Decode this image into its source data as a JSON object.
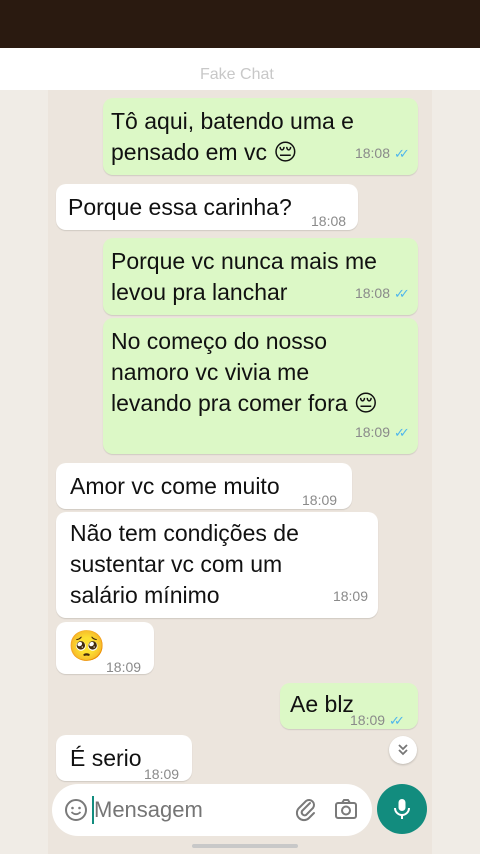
{
  "header": {
    "title": "Fake Chat"
  },
  "messages": [
    {
      "dir": "out",
      "text": "Tô aqui, batendo uma e\npensado em vc 😔",
      "time": "18:08"
    },
    {
      "dir": "in",
      "text": "Porque essa carinha?",
      "time": "18:08"
    },
    {
      "dir": "out",
      "text": "Porque vc nunca mais me\nlevou pra lanchar",
      "time": "18:08"
    },
    {
      "dir": "out",
      "text": "No começo do nosso\nnamoro vc vivia me\nlevando pra comer fora 😔",
      "time": "18:09"
    },
    {
      "dir": "in",
      "text": "Amor vc come muito",
      "time": "18:09"
    },
    {
      "dir": "in",
      "text": "Não tem condições de\nsustentar vc com um\nsalário mínimo",
      "time": "18:09"
    },
    {
      "dir": "in",
      "text": "🥺",
      "time": "18:09"
    },
    {
      "dir": "out",
      "text": "Ae blz",
      "time": "18:09"
    },
    {
      "dir": "in",
      "text": "É serio",
      "time": "18:09"
    }
  ],
  "composer": {
    "placeholder": "Mensagem"
  },
  "icons": {
    "emoji": "emoji-icon",
    "attach": "paperclip-icon",
    "camera": "camera-icon",
    "mic": "mic-icon",
    "scroll": "chevron-double-down-icon",
    "read_receipt": "double-check-icon"
  },
  "colors": {
    "outgoing_bubble": "#dcf8c6",
    "incoming_bubble": "#ffffff",
    "read_ticks": "#4fb6ec",
    "mic_button": "#128c7e",
    "chat_background": "#ece5dd"
  }
}
